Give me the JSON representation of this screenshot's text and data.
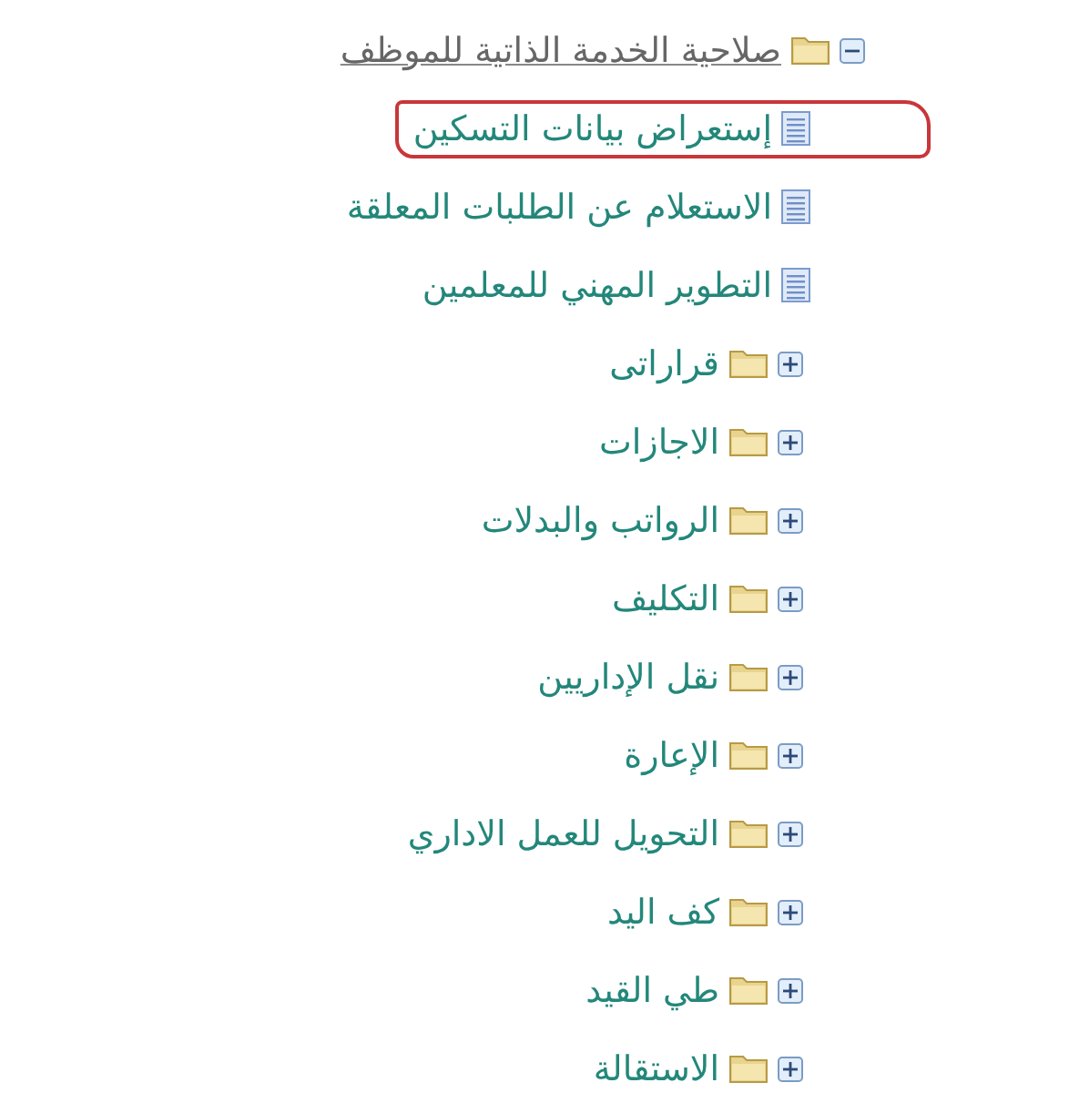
{
  "tree": {
    "label": "صلاحية الخدمة الذاتية للموظف",
    "kind": "folder",
    "expanded": true,
    "children": [
      {
        "label": "إستعراض بيانات التسكين",
        "kind": "document",
        "circled": true
      },
      {
        "label": "الاستعلام عن الطلبات المعلقة",
        "kind": "document",
        "circled": false
      },
      {
        "label": "التطوير المهني للمعلمين",
        "kind": "document",
        "circled": false
      },
      {
        "label": "قراراتى",
        "kind": "folder",
        "expanded": false
      },
      {
        "label": "الاجازات",
        "kind": "folder",
        "expanded": false
      },
      {
        "label": "الرواتب والبدلات",
        "kind": "folder",
        "expanded": false
      },
      {
        "label": "التكليف",
        "kind": "folder",
        "expanded": false
      },
      {
        "label": "نقل الإداريين",
        "kind": "folder",
        "expanded": false
      },
      {
        "label": "الإعارة",
        "kind": "folder",
        "expanded": false
      },
      {
        "label": "التحويل للعمل الاداري",
        "kind": "folder",
        "expanded": false
      },
      {
        "label": "كف اليد",
        "kind": "folder",
        "expanded": false
      },
      {
        "label": "طي القيد",
        "kind": "folder",
        "expanded": false
      },
      {
        "label": "الاستقالة",
        "kind": "folder",
        "expanded": false
      }
    ]
  }
}
